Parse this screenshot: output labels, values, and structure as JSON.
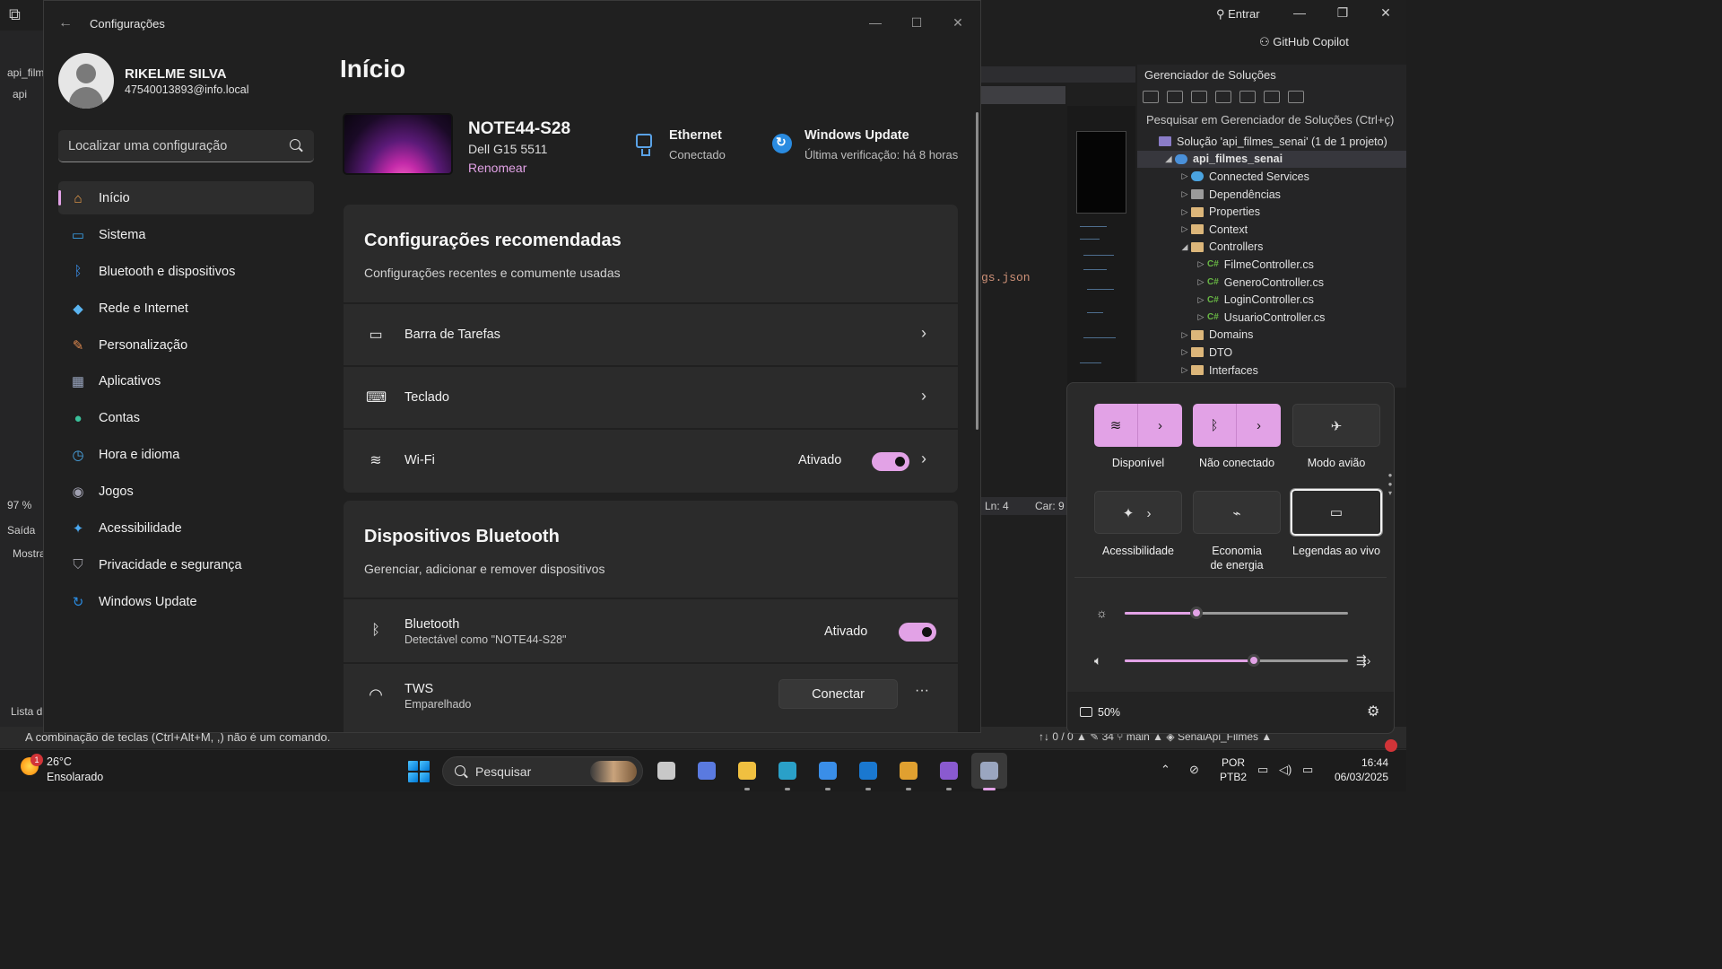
{
  "vs": {
    "entrar": "Entrar",
    "copilot": "GitHub Copilot",
    "left_tab": "api_film",
    "left_tab2": "api",
    "zoom": "97 %",
    "output": "Saída",
    "output_sub": "Mostra",
    "list": "Lista d",
    "code_snippet": "gs.json",
    "ln": "Ln: 4",
    "car": "Car: 9",
    "bottom_msg": "A combinação de teclas (Ctrl+Alt+M, ,) não é um comando.",
    "bottom_right": "↑↓ 0 / 0 ▲   ✎ 34   ⑂ main ▲   ◈ SenaiApi_Filmes ▲"
  },
  "solution": {
    "title": "Gerenciador de Soluções",
    "search_placeholder": "Pesquisar em Gerenciador de Soluções (Ctrl+ç)",
    "items": [
      {
        "label": "Solução 'api_filmes_senai' (1 de 1 projeto)",
        "indent": 0,
        "icon": "sol",
        "caret": ""
      },
      {
        "label": "api_filmes_senai",
        "indent": 1,
        "icon": "proj",
        "caret": "◢",
        "selected": true
      },
      {
        "label": "Connected Services",
        "indent": 2,
        "icon": "svc",
        "caret": "▷"
      },
      {
        "label": "Dependências",
        "indent": 2,
        "icon": "dep",
        "caret": "▷"
      },
      {
        "label": "Properties",
        "indent": 2,
        "icon": "folder",
        "caret": "▷"
      },
      {
        "label": "Context",
        "indent": 2,
        "icon": "folder",
        "caret": "▷"
      },
      {
        "label": "Controllers",
        "indent": 2,
        "icon": "folder",
        "caret": "◢"
      },
      {
        "label": "FilmeController.cs",
        "indent": 3,
        "icon": "cs",
        "caret": "▷"
      },
      {
        "label": "GeneroController.cs",
        "indent": 3,
        "icon": "cs",
        "caret": "▷"
      },
      {
        "label": "LoginController.cs",
        "indent": 3,
        "icon": "cs",
        "caret": "▷"
      },
      {
        "label": "UsuarioController.cs",
        "indent": 3,
        "icon": "cs",
        "caret": "▷"
      },
      {
        "label": "Domains",
        "indent": 2,
        "icon": "folder",
        "caret": "▷"
      },
      {
        "label": "DTO",
        "indent": 2,
        "icon": "folder",
        "caret": "▷"
      },
      {
        "label": "Interfaces",
        "indent": 2,
        "icon": "folder",
        "caret": "▷"
      }
    ]
  },
  "settings": {
    "window_title": "Configurações",
    "user_name": "RIKELME SILVA",
    "user_email": "47540013893@info.local",
    "search_placeholder": "Localizar uma configuração",
    "nav": [
      {
        "label": "Início",
        "icon": "home-icon",
        "glyph": "⌂",
        "color": "#f0a04b",
        "active": true
      },
      {
        "label": "Sistema",
        "icon": "system-icon",
        "glyph": "▭",
        "color": "#3aa0e8"
      },
      {
        "label": "Bluetooth e dispositivos",
        "icon": "bluetooth-icon",
        "glyph": "ᛒ",
        "color": "#3a8ee8"
      },
      {
        "label": "Rede e Internet",
        "icon": "network-icon",
        "glyph": "◆",
        "color": "#5ab4f0"
      },
      {
        "label": "Personalização",
        "icon": "brush-icon",
        "glyph": "✎",
        "color": "#e08a50"
      },
      {
        "label": "Aplicativos",
        "icon": "apps-icon",
        "glyph": "▦",
        "color": "#9aa6c0"
      },
      {
        "label": "Contas",
        "icon": "accounts-icon",
        "glyph": "●",
        "color": "#3ac09a"
      },
      {
        "label": "Hora e idioma",
        "icon": "time-language-icon",
        "glyph": "◷",
        "color": "#4aa8e8"
      },
      {
        "label": "Jogos",
        "icon": "gaming-icon",
        "glyph": "◉",
        "color": "#a0a0b0"
      },
      {
        "label": "Acessibilidade",
        "icon": "accessibility-icon",
        "glyph": "✦",
        "color": "#4aa8f0"
      },
      {
        "label": "Privacidade e segurança",
        "icon": "shield-icon",
        "glyph": "⛉",
        "color": "#a0a0a8"
      },
      {
        "label": "Windows Update",
        "icon": "windows-update-icon",
        "glyph": "↻",
        "color": "#2a8be0"
      }
    ],
    "page_title": "Início",
    "device": {
      "name": "NOTE44-S28",
      "model": "Dell G15 5511",
      "rename": "Renomear"
    },
    "ethernet": {
      "title": "Ethernet",
      "status": "Conectado"
    },
    "update": {
      "title": "Windows Update",
      "status": "Última verificação: há 8 horas"
    },
    "recommended": {
      "title": "Configurações recomendadas",
      "subtitle": "Configurações recentes e comumente usadas",
      "rows": [
        {
          "label": "Barra de Tarefas",
          "icon": "taskbar-icon",
          "glyph": "▭"
        },
        {
          "label": "Teclado",
          "icon": "keyboard-icon",
          "glyph": "⌨"
        },
        {
          "label": "Wi-Fi",
          "icon": "wifi-icon",
          "glyph": "≋",
          "state": "Ativado",
          "toggle": true
        }
      ]
    },
    "bluetooth": {
      "title": "Dispositivos Bluetooth",
      "subtitle": "Gerenciar, adicionar e remover dispositivos",
      "bt_label": "Bluetooth",
      "bt_sub": "Detectável como \"NOTE44-S28\"",
      "bt_state": "Ativado",
      "device_label": "TWS",
      "device_sub": "Emparelhado",
      "connect": "Conectar",
      "more": "···"
    }
  },
  "quick_settings": {
    "tiles": [
      {
        "label": "Disponível",
        "icon": "wifi-icon",
        "glyph": "≋",
        "state": "on",
        "split": true
      },
      {
        "label": "Não conectado",
        "icon": "bluetooth-icon",
        "glyph": "ᛒ",
        "state": "on",
        "split": true
      },
      {
        "label": "Modo avião",
        "icon": "airplane-icon",
        "glyph": "✈",
        "state": "off"
      },
      {
        "label": "Acessibilidade",
        "icon": "accessibility-icon",
        "glyph": "✦",
        "state": "off",
        "chevron": true
      },
      {
        "label": "Economia\nde energia",
        "icon": "battery-saver-icon",
        "glyph": "⌁",
        "state": "off"
      },
      {
        "label": "Legendas ao vivo",
        "icon": "live-captions-icon",
        "glyph": "▭",
        "state": "sel"
      }
    ],
    "brightness": 0.32,
    "volume": 0.58,
    "battery": "50%"
  },
  "taskbar": {
    "temp": "26°C",
    "weather": "Ensolarado",
    "weather_badge": "1",
    "search": "Pesquisar",
    "lang1": "POR",
    "lang2": "PTB2",
    "time": "16:44",
    "date": "06/03/2025",
    "apps": [
      {
        "name": "task-view-icon",
        "color": "#c8c8c8"
      },
      {
        "name": "m365-copilot-icon",
        "color": "#5a7ae0"
      },
      {
        "name": "file-explorer-icon",
        "color": "#f0c040"
      },
      {
        "name": "edge-icon",
        "color": "#2aa0c8"
      },
      {
        "name": "microsoft-store-icon",
        "color": "#3a8ee8"
      },
      {
        "name": "outlook-icon",
        "color": "#1a78d0"
      },
      {
        "name": "chrome-icon",
        "color": "#e0a030"
      },
      {
        "name": "visual-studio-icon",
        "color": "#8a5ad0"
      },
      {
        "name": "settings-app-icon",
        "color": "#9aa6c0"
      }
    ]
  },
  "colors": {
    "accent": "#e2a2e6",
    "background": "#202020",
    "card": "#2b2b2b"
  }
}
